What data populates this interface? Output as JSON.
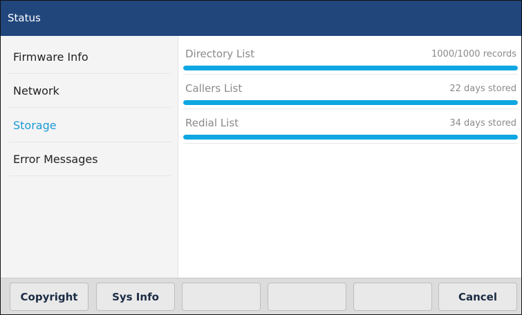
{
  "header": {
    "title": "Status"
  },
  "sidebar": {
    "items": [
      {
        "label": "Firmware Info",
        "active": false
      },
      {
        "label": "Network",
        "active": false
      },
      {
        "label": "Storage",
        "active": true
      },
      {
        "label": "Error Messages",
        "active": false
      }
    ]
  },
  "storage": {
    "rows": [
      {
        "label": "Directory List",
        "value": "1000/1000 records",
        "fill_percent": 100
      },
      {
        "label": "Callers List",
        "value": "22 days stored",
        "fill_percent": 100
      },
      {
        "label": "Redial List",
        "value": "34 days stored",
        "fill_percent": 100
      }
    ]
  },
  "softkeys": {
    "copyright": "Copyright",
    "sys_info": "Sys Info",
    "empty1": "",
    "empty2": "",
    "empty3": "",
    "cancel": "Cancel"
  },
  "colors": {
    "titlebar": "#21467c",
    "accent": "#1a9ad6",
    "progress": "#0ea7e2"
  }
}
